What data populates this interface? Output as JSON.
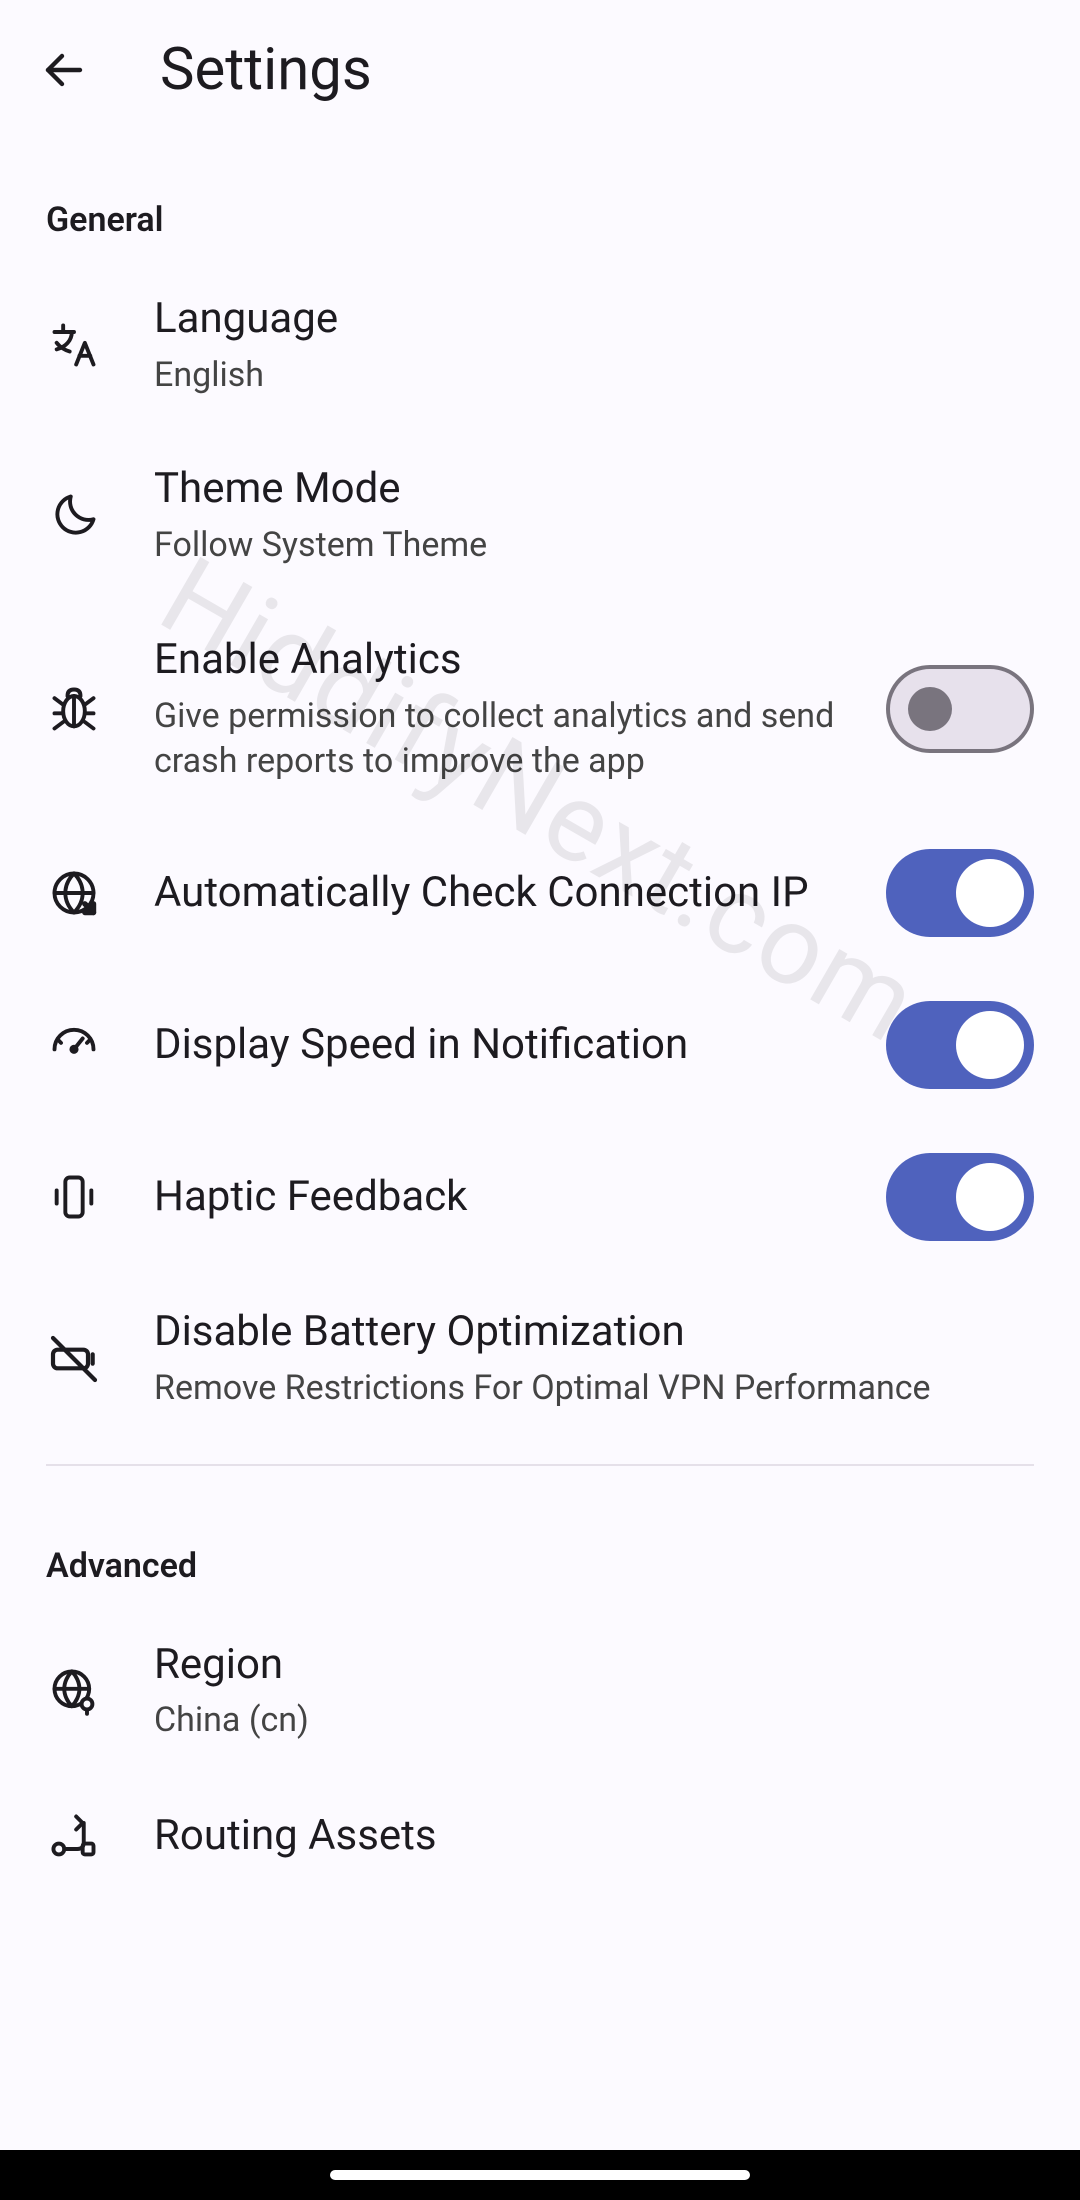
{
  "appbar": {
    "title": "Settings"
  },
  "sections": {
    "general": {
      "header": "General",
      "language": {
        "title": "Language",
        "subtitle": "English"
      },
      "theme": {
        "title": "Theme Mode",
        "subtitle": "Follow System Theme"
      },
      "analytics": {
        "title": "Enable Analytics",
        "subtitle": "Give permission to collect analytics and send crash reports to improve the app",
        "on": false
      },
      "autoip": {
        "title": "Automatically Check Connection IP",
        "on": true
      },
      "speed": {
        "title": "Display Speed in Notification",
        "on": true
      },
      "haptic": {
        "title": "Haptic Feedback",
        "on": true
      },
      "battery": {
        "title": "Disable Battery Optimization",
        "subtitle": "Remove Restrictions For Optimal VPN Performance"
      }
    },
    "advanced": {
      "header": "Advanced",
      "region": {
        "title": "Region",
        "subtitle": "China (cn)"
      },
      "routing": {
        "title": "Routing Assets"
      }
    }
  },
  "watermark": "HiddifyNext.com"
}
